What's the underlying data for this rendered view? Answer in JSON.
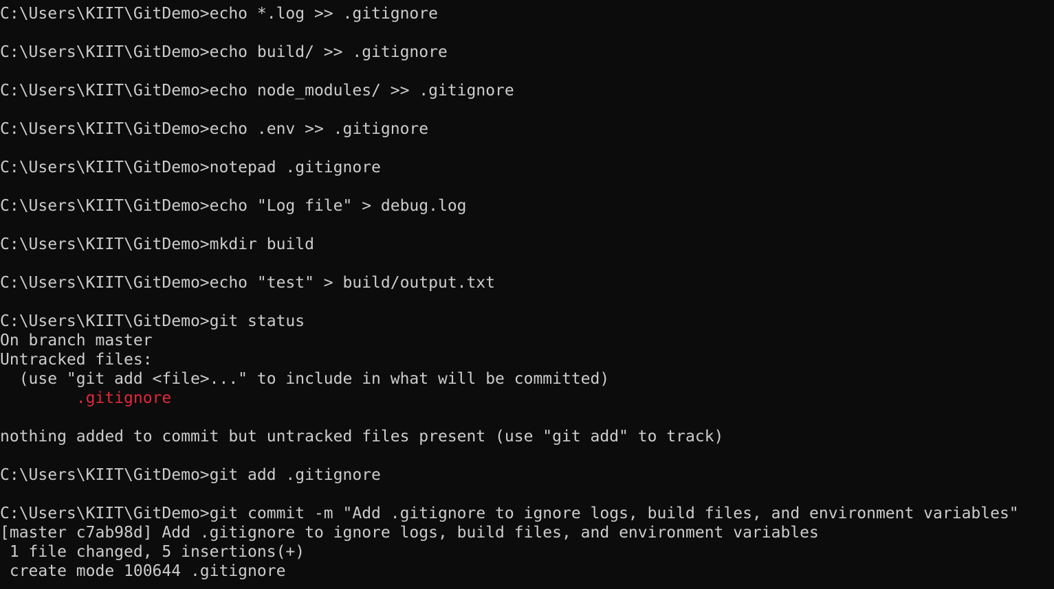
{
  "terminal": {
    "colors": {
      "background": "#0c0c0c",
      "foreground": "#cccccc",
      "untracked": "#e0293a"
    },
    "lines": [
      {
        "text": "C:\\Users\\KIIT\\GitDemo>echo *.log >> .gitignore"
      },
      {
        "text": ""
      },
      {
        "text": "C:\\Users\\KIIT\\GitDemo>echo build/ >> .gitignore"
      },
      {
        "text": ""
      },
      {
        "text": "C:\\Users\\KIIT\\GitDemo>echo node_modules/ >> .gitignore"
      },
      {
        "text": ""
      },
      {
        "text": "C:\\Users\\KIIT\\GitDemo>echo .env >> .gitignore"
      },
      {
        "text": ""
      },
      {
        "text": "C:\\Users\\KIIT\\GitDemo>notepad .gitignore"
      },
      {
        "text": ""
      },
      {
        "text": "C:\\Users\\KIIT\\GitDemo>echo \"Log file\" > debug.log"
      },
      {
        "text": ""
      },
      {
        "text": "C:\\Users\\KIIT\\GitDemo>mkdir build"
      },
      {
        "text": ""
      },
      {
        "text": "C:\\Users\\KIIT\\GitDemo>echo \"test\" > build/output.txt"
      },
      {
        "text": ""
      },
      {
        "text": "C:\\Users\\KIIT\\GitDemo>git status"
      },
      {
        "text": "On branch master"
      },
      {
        "text": "Untracked files:"
      },
      {
        "text": "  (use \"git add <file>...\" to include in what will be committed)"
      },
      {
        "text": "        .gitignore",
        "red": true
      },
      {
        "text": ""
      },
      {
        "text": "nothing added to commit but untracked files present (use \"git add\" to track)"
      },
      {
        "text": ""
      },
      {
        "text": "C:\\Users\\KIIT\\GitDemo>git add .gitignore"
      },
      {
        "text": ""
      },
      {
        "text": "C:\\Users\\KIIT\\GitDemo>git commit -m \"Add .gitignore to ignore logs, build files, and environment variables\""
      },
      {
        "text": "[master c7ab98d] Add .gitignore to ignore logs, build files, and environment variables"
      },
      {
        "text": " 1 file changed, 5 insertions(+)"
      },
      {
        "text": " create mode 100644 .gitignore"
      }
    ]
  }
}
